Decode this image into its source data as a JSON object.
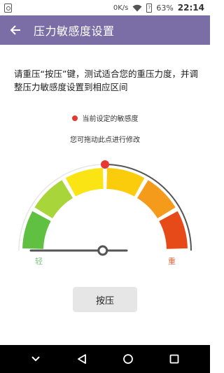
{
  "status_bar": {
    "network_speed": "0K/s",
    "battery_percent": "63%",
    "battery_charge": 0.63,
    "time": "22:14",
    "icons": [
      "sim-icon",
      "wifi-icon",
      "battery-icon"
    ]
  },
  "app_bar": {
    "title": "压力敏感度设置",
    "back_icon": "arrow-back-icon",
    "color": "#7b6ea6"
  },
  "instructions": "请重压“按压”键，测试适合您的重压力度，并调整压力敏感度设置到相应区间",
  "legend": {
    "label": "当前设定的敏感度",
    "dot_color": "#e53935"
  },
  "hint": "您可拖动此点进行修改",
  "gauge": {
    "label_light": "轻",
    "label_heavy": "重",
    "segments": [
      {
        "color": "#5fc041"
      },
      {
        "color": "#a8d63a"
      },
      {
        "color": "#fbe413"
      },
      {
        "color": "#fbcc0b"
      },
      {
        "color": "#f59b1b"
      },
      {
        "color": "#e64a19"
      }
    ],
    "current_setting": 0.5,
    "slider_value": 0.75
  },
  "press_button_label": "按压",
  "nav_bar": {
    "icons": [
      "chevron-down-icon",
      "back-triangle-icon",
      "home-circle-icon",
      "recents-square-icon"
    ]
  }
}
